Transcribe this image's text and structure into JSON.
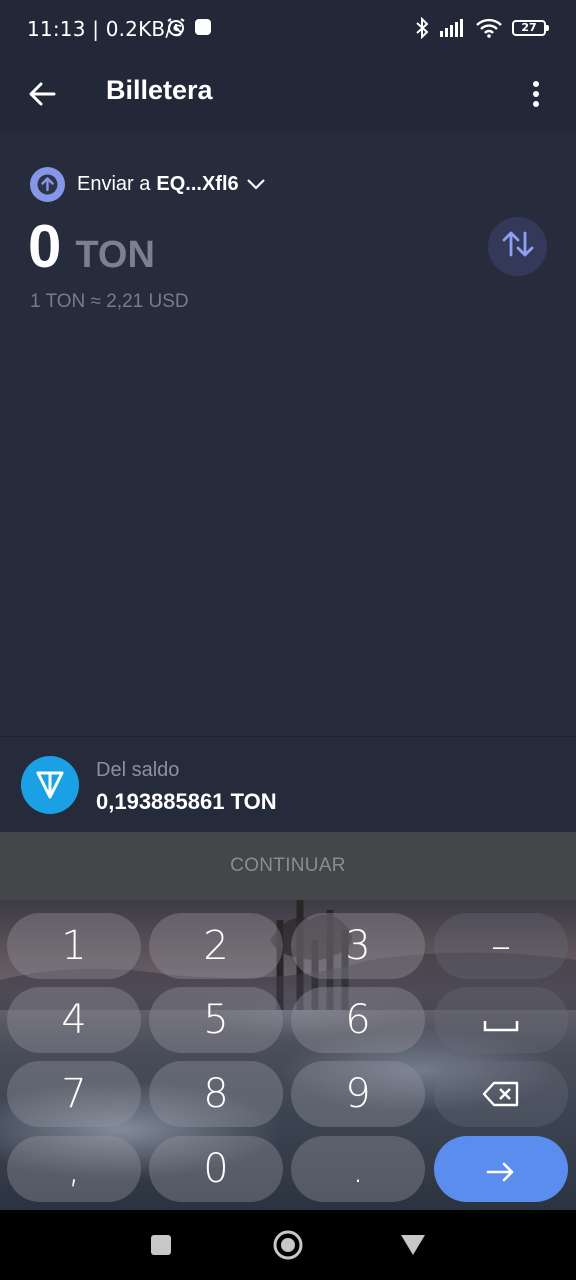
{
  "status_bar": {
    "time": "11:13 | 0.2KB/s",
    "battery": "27",
    "icons": [
      "alarm-icon",
      "notification-square-icon",
      "bluetooth-icon",
      "signal-icon",
      "wifi-icon",
      "battery-icon"
    ]
  },
  "app_bar": {
    "title": "Billetera",
    "icons": [
      "back-arrow-icon",
      "more-vertical-icon"
    ]
  },
  "send": {
    "recipient_prefix": "Enviar a",
    "recipient_address": "EQ...Xfl6",
    "amount_value": "0",
    "amount_currency": "TON",
    "rate": "1 TON ≈ 2,21 USD"
  },
  "balance": {
    "label": "Del saldo",
    "value": "0,193885861 TON"
  },
  "continue_label": "CONTINUAR",
  "keyboard": {
    "keys": [
      "1",
      "2",
      "3",
      "–",
      "4",
      "5",
      "6",
      "␣",
      "7",
      "8",
      "9",
      "⌫",
      ",",
      "0",
      ".",
      "→"
    ]
  },
  "colors": {
    "background": "#272c3d",
    "accent": "#5b8def",
    "ton_blue": "#1aa1e5",
    "avatar": "#8797e8"
  }
}
